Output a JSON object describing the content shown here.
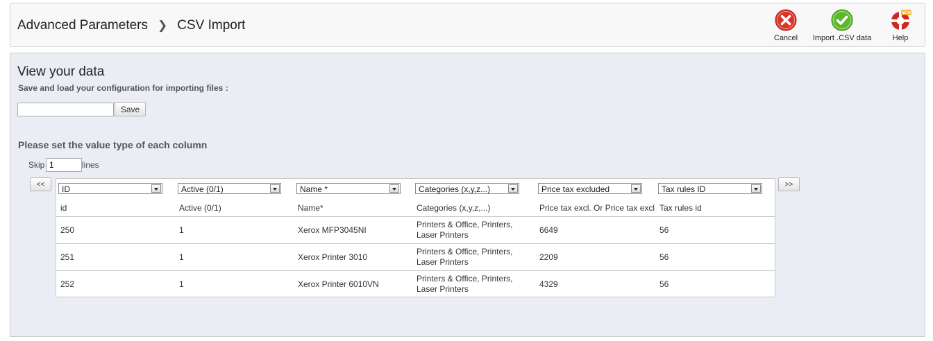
{
  "breadcrumb": {
    "parent": "Advanced Parameters",
    "current": "CSV Import"
  },
  "toolbar": {
    "cancel": "Cancel",
    "import": "Import .CSV data",
    "help": "Help",
    "help_badge": "NEW"
  },
  "panel": {
    "title": "View your data",
    "subtitle": "Save and load your configuration for importing files :",
    "config_value": "",
    "save_label": "Save",
    "column_heading": "Please set the value type of each column",
    "skip_label": "Skip",
    "skip_value": "1",
    "lines_label": "lines",
    "prev_label": "<<",
    "next_label": ">>"
  },
  "columns": {
    "selects": [
      "ID",
      "Active (0/1)",
      "Name *",
      "Categories (x,y,z...)",
      "Price tax excluded",
      "Tax rules ID"
    ],
    "headers": [
      "id",
      "Active (0/1)",
      "Name*",
      "Categories (x,y,z,...)",
      "Price tax excl. Or Price tax excl",
      "Tax rules id"
    ]
  },
  "rows": [
    {
      "id": "250",
      "active": "1",
      "name": "Xerox MFP3045NI",
      "cat1": "Printers & Office, Printers,",
      "cat2": "Laser Printers",
      "price": "6649",
      "tax": "56"
    },
    {
      "id": "251",
      "active": "1",
      "name": "Xerox Printer 3010",
      "cat1": "Printers & Office, Printers,",
      "cat2": "Laser Printers",
      "price": "2209",
      "tax": "56"
    },
    {
      "id": "252",
      "active": "1",
      "name": "Xerox Printer 6010VN",
      "cat1": "Printers & Office, Printers,",
      "cat2": "Laser Printers",
      "price": "4329",
      "tax": "56"
    }
  ],
  "colors": {
    "panel_bg": "#ebedf4",
    "cancel_red": "#d9342a",
    "import_green": "#5cb82a",
    "help_red": "#cc2a20"
  }
}
